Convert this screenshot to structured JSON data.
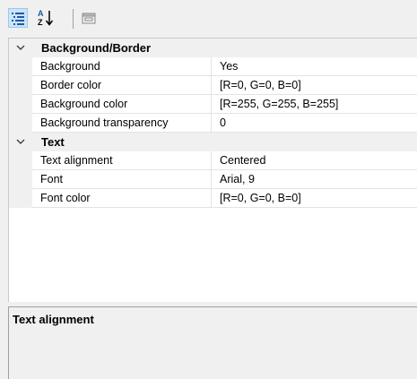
{
  "toolbar": {
    "buttons": [
      {
        "icon": "categorized-icon",
        "active": true
      },
      {
        "icon": "alphabetical-sort-icon",
        "active": false
      },
      {
        "icon": "property-pages-icon",
        "active": false
      }
    ],
    "alpha_glyph_top": "A",
    "alpha_glyph_bottom": "Z"
  },
  "grid": {
    "categories": [
      {
        "label": "Background/Border",
        "expanded": true,
        "properties": [
          {
            "name": "Background",
            "value": "Yes"
          },
          {
            "name": "Border color",
            "value": "[R=0, G=0, B=0]"
          },
          {
            "name": "Background color",
            "value": "[R=255, G=255, B=255]"
          },
          {
            "name": "Background transparency",
            "value": "0"
          }
        ]
      },
      {
        "label": "Text",
        "expanded": true,
        "properties": [
          {
            "name": "Text alignment",
            "value": "Centered"
          },
          {
            "name": "Font",
            "value": "Arial, 9"
          },
          {
            "name": "Font color",
            "value": "[R=0, G=0, B=0]"
          }
        ]
      }
    ]
  },
  "description": {
    "title": "Text alignment",
    "text": ""
  },
  "colors": {
    "toolbar_active_bg": "#cce4f7",
    "toolbar_active_border": "#99c9ef",
    "icon_blue": "#1e5aa8",
    "grid_line": "#e3e3e3",
    "category_bg": "#f0f0f0"
  }
}
